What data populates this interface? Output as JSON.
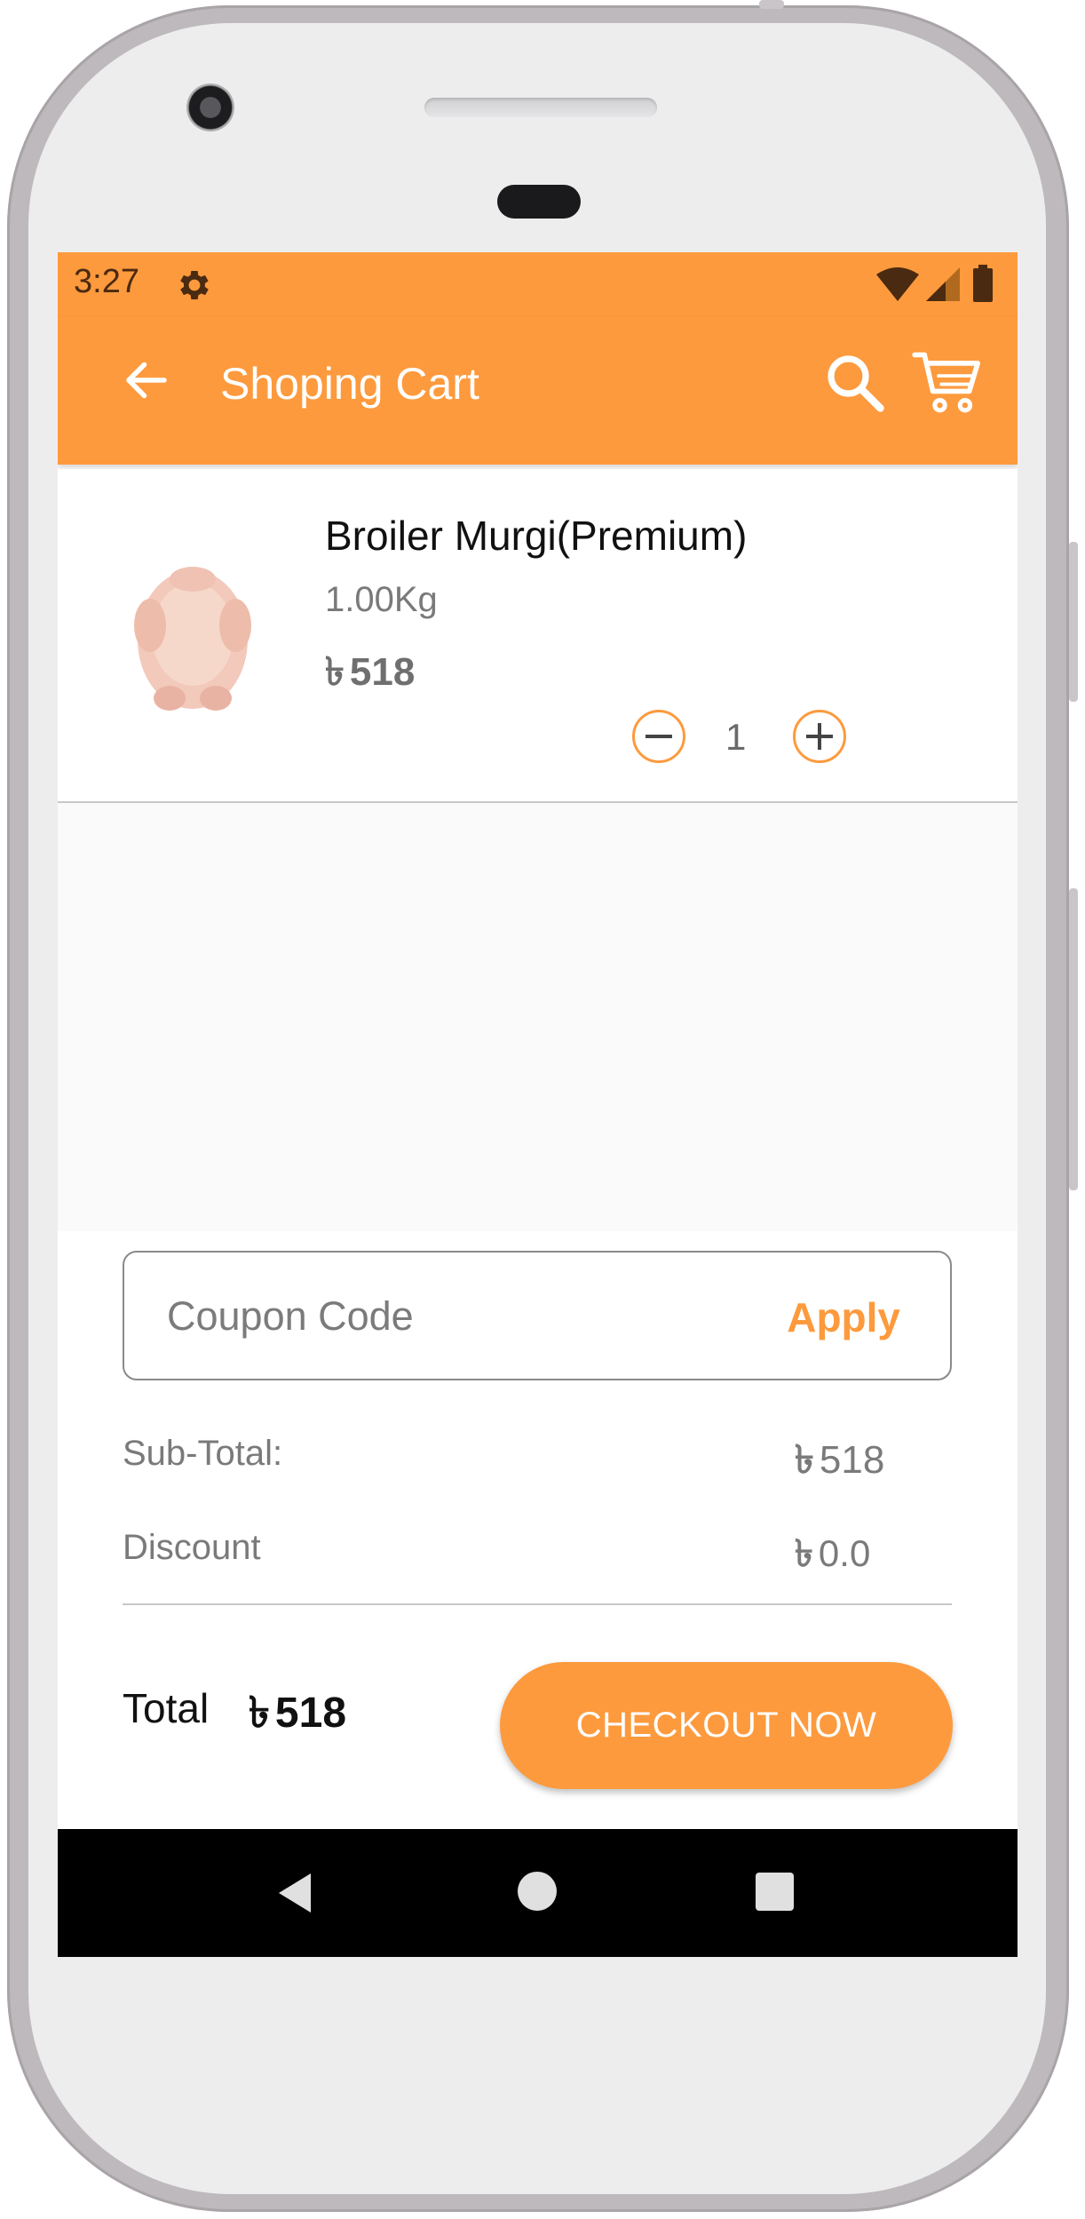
{
  "status_bar": {
    "time": "3:27",
    "icons": [
      "gear-icon",
      "wifi-icon",
      "signal-icon",
      "battery-icon"
    ]
  },
  "app_bar": {
    "title": "Shoping Cart",
    "icons": [
      "back-arrow-icon",
      "search-icon",
      "cart-icon"
    ]
  },
  "cart": {
    "items": [
      {
        "name": "Broiler Murgi(Premium)",
        "weight": "1.00Kg",
        "currency": "৳",
        "price": "518",
        "quantity": "1"
      }
    ]
  },
  "coupon": {
    "placeholder": "Coupon Code",
    "apply_label": "Apply"
  },
  "summary": {
    "currency": "৳",
    "subtotal_label": "Sub-Total:",
    "subtotal_value": "518",
    "discount_label": "Discount",
    "discount_value": "0.0",
    "total_label": "Total",
    "total_value": "518",
    "checkout_label": "CHECKOUT NOW"
  },
  "nav_bar": {
    "icons": [
      "nav-back-icon",
      "nav-home-icon",
      "nav-recents-icon"
    ]
  },
  "colors": {
    "accent": "#fd9a3d",
    "nav_background": "#000000",
    "screen_background": "#fafafa"
  }
}
